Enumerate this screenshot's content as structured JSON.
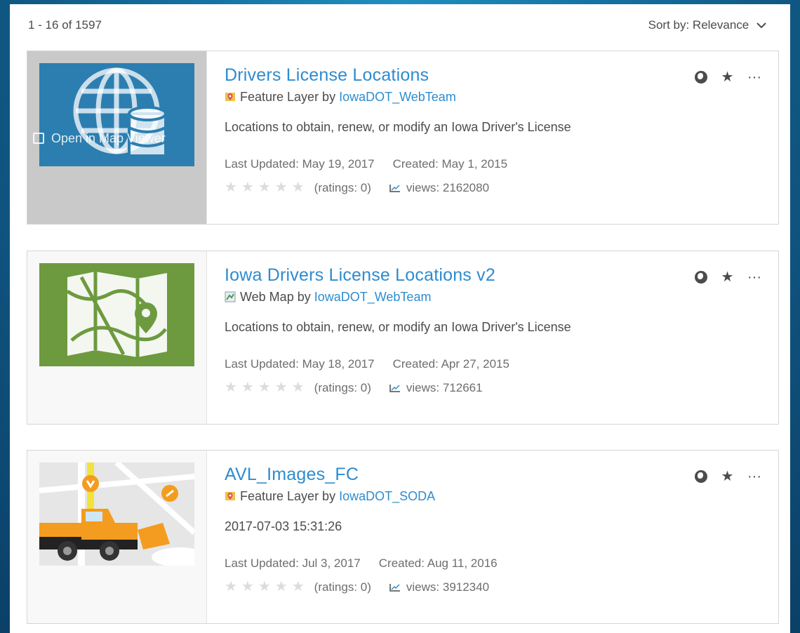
{
  "results": {
    "count_label": "1 - 16 of 1597",
    "sort_label": "Sort by: Relevance",
    "sort_chevron": "⌵"
  },
  "overlay": {
    "open_label": "Open in Map Viewer"
  },
  "items": [
    {
      "title": "Drivers License Locations",
      "type_prefix": "Feature Layer by ",
      "owner": "IowaDOT_WebTeam",
      "description": "Locations to obtain, renew, or modify an Iowa Driver's License",
      "last_updated": "Last Updated: May 19, 2017",
      "created": "Created: May 1, 2015",
      "ratings": "(ratings: 0)",
      "views": "views: 2162080",
      "thumb_icon": "globe-database-icon",
      "type_icon": "feature-layer-icon"
    },
    {
      "title": "Iowa Drivers License Locations v2",
      "type_prefix": "Web Map by ",
      "owner": "IowaDOT_WebTeam",
      "description": "Locations to obtain, renew, or modify an Iowa Driver's License",
      "last_updated": "Last Updated: May 18, 2017",
      "created": "Created: Apr 27, 2015",
      "ratings": "(ratings: 0)",
      "views": "views: 712661",
      "thumb_icon": "folded-map-pin-icon",
      "type_icon": "web-map-icon"
    },
    {
      "title": "AVL_Images_FC",
      "type_prefix": "Feature Layer by ",
      "owner": "IowaDOT_SODA",
      "description": "2017-07-03 15:31:26",
      "last_updated": "Last Updated: Jul 3, 2017",
      "created": "Created: Aug 11, 2016",
      "ratings": "(ratings: 0)",
      "views": "views: 3912340",
      "thumb_icon": "snowplow-truck-icon",
      "type_icon": "feature-layer-icon"
    }
  ],
  "actions": {
    "star": "★",
    "more": "···",
    "rating_stars": "★★★★★"
  },
  "colors": {
    "link": "#2e8ccf",
    "thumb_blue": "#2c7eb0",
    "thumb_green": "#6d9a3e",
    "plow_orange": "#f39c1f"
  }
}
